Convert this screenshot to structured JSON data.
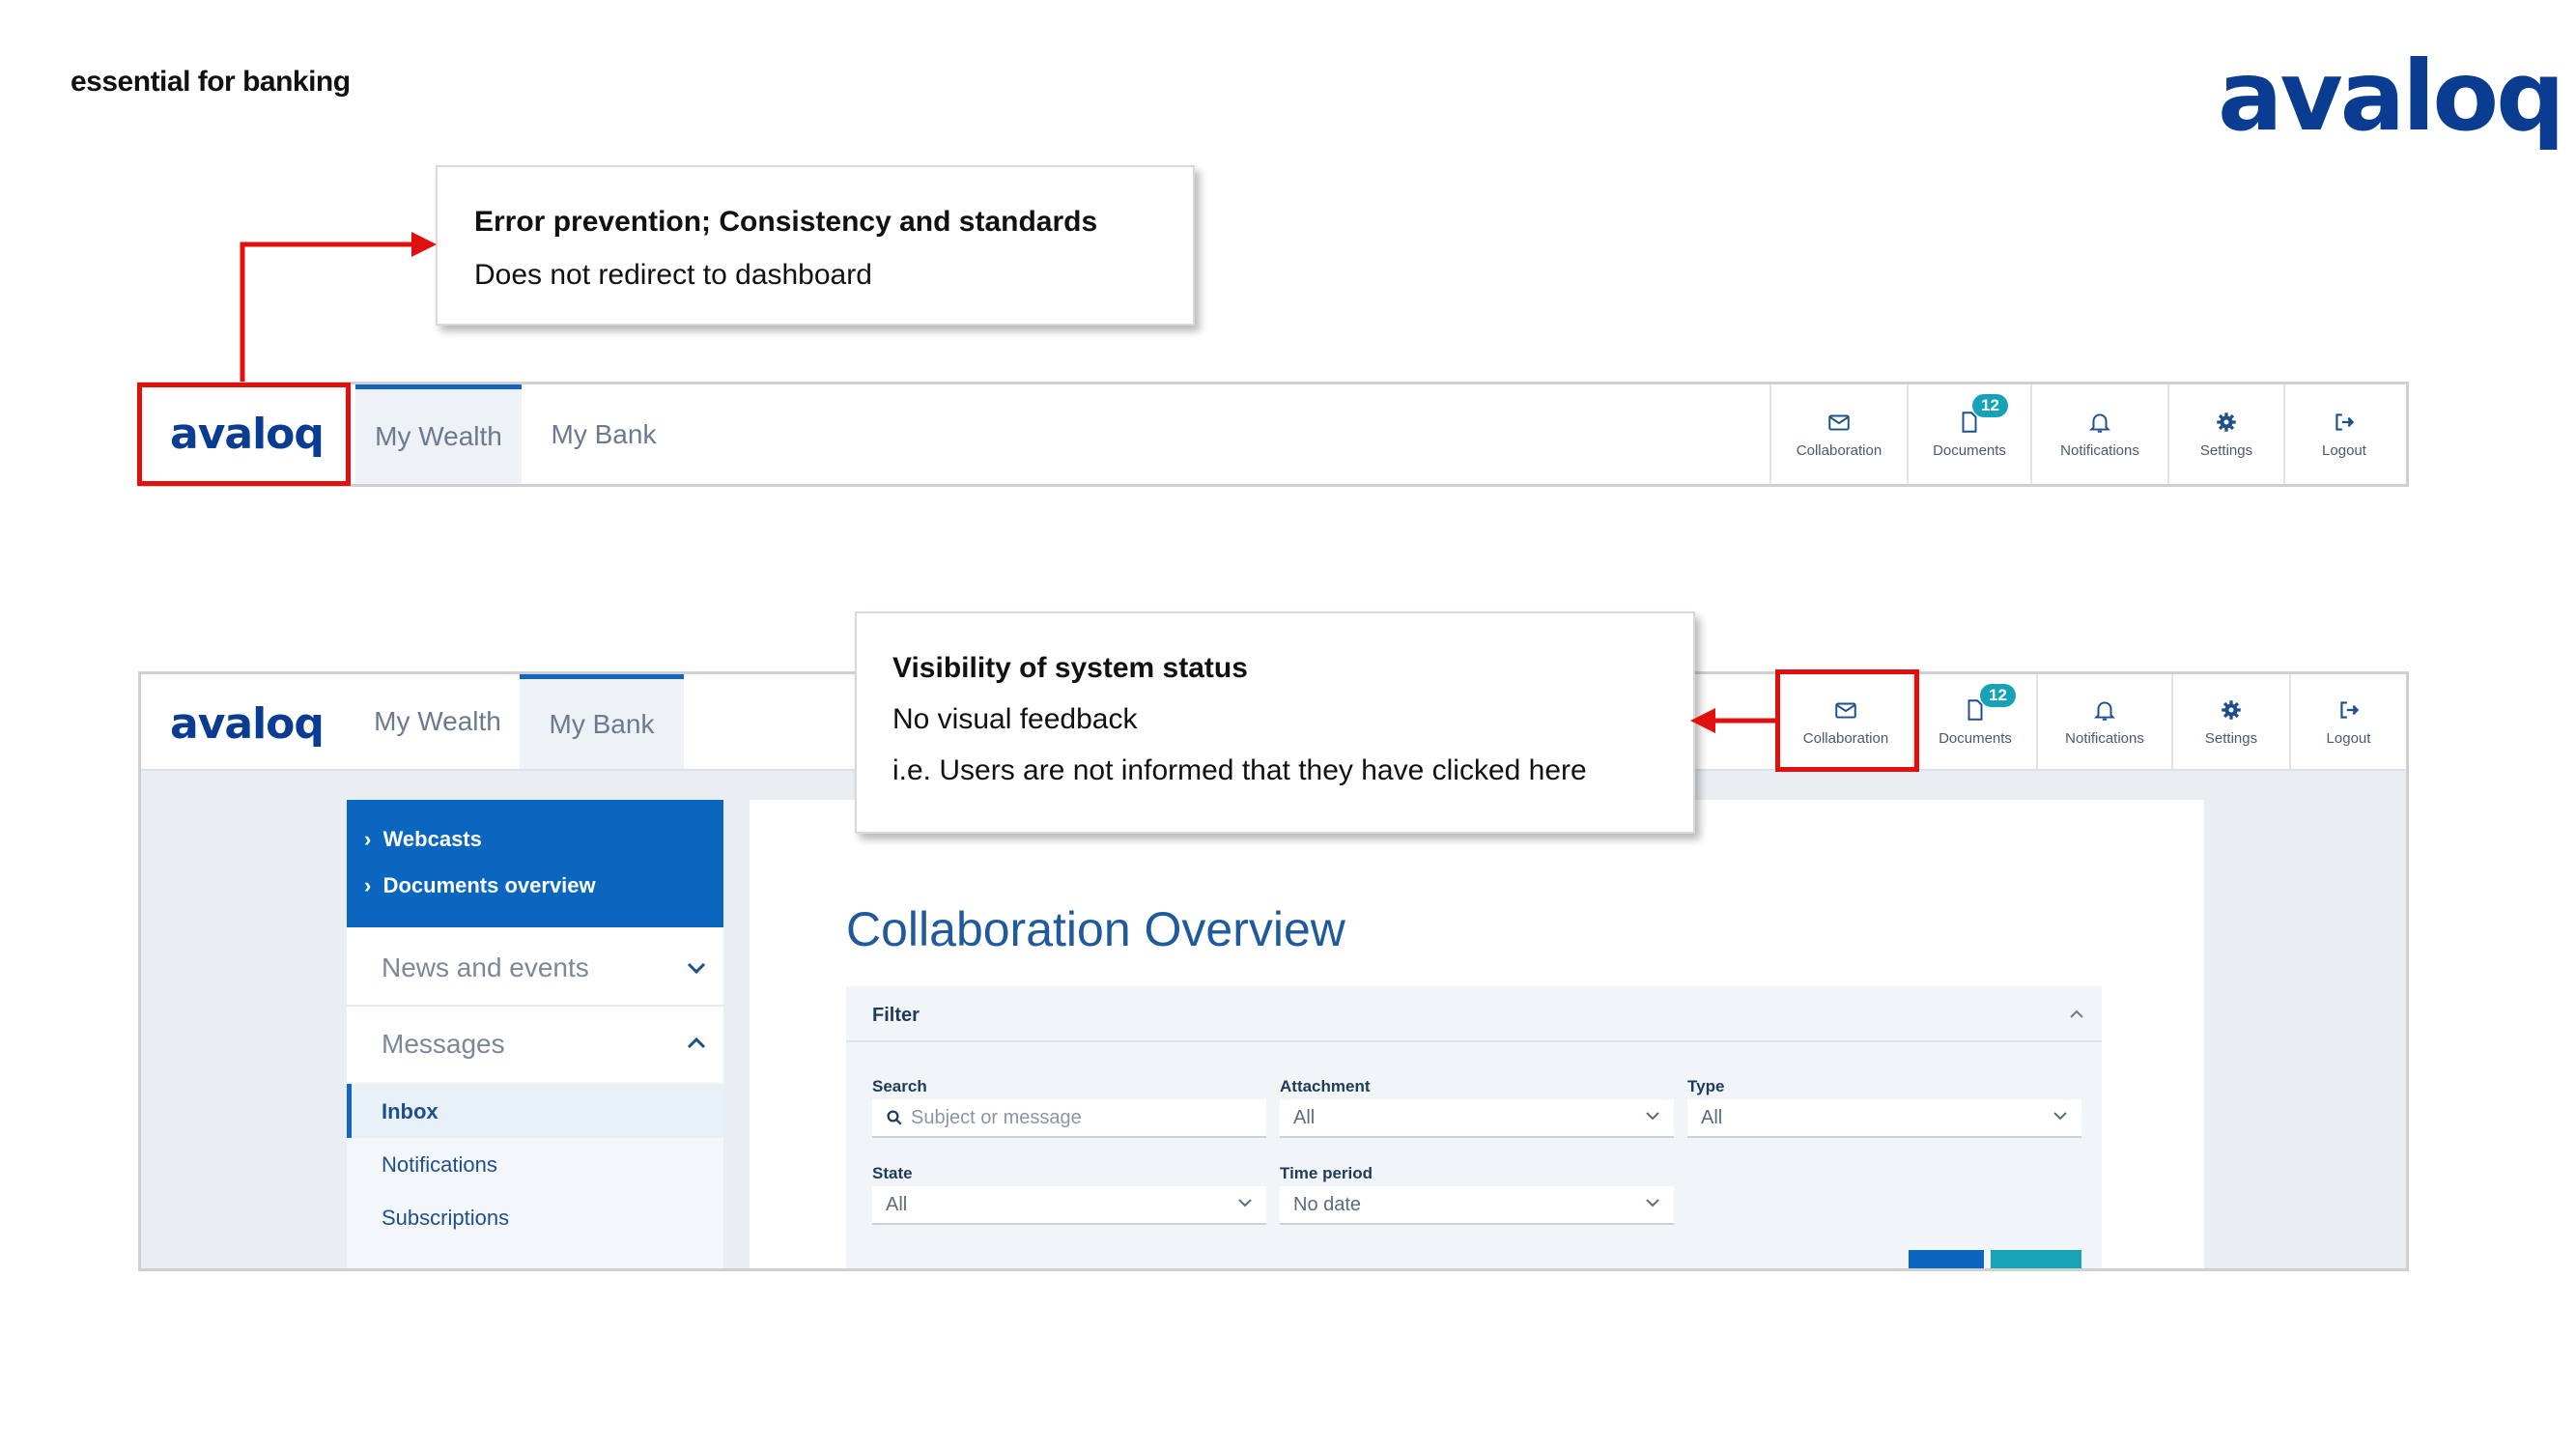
{
  "header": {
    "tagline": "essential for banking",
    "logo": "avaloq"
  },
  "callouts": [
    {
      "title": "Error prevention; Consistency and standards",
      "lines": [
        "Does not redirect to dashboard"
      ]
    },
    {
      "title": "Visibility of system status",
      "lines": [
        "No visual feedback",
        "i.e. Users are not informed that they have clicked here"
      ]
    }
  ],
  "app": {
    "logo": "avaloq",
    "tabs": [
      "My Wealth",
      "My Bank"
    ],
    "nav": [
      {
        "label": "Collaboration",
        "icon": "envelope-icon"
      },
      {
        "label": "Documents",
        "icon": "document-icon",
        "badge": "12"
      },
      {
        "label": "Notifications",
        "icon": "bell-icon"
      },
      {
        "label": "Settings",
        "icon": "gear-icon"
      },
      {
        "label": "Logout",
        "icon": "logout-icon"
      }
    ]
  },
  "sidebar": {
    "top_items": [
      "Webcasts",
      "Documents overview"
    ],
    "sections": [
      "News and events",
      "Messages"
    ],
    "message_items": [
      "Inbox",
      "Notifications",
      "Subscriptions"
    ]
  },
  "main": {
    "title": "Collaboration Overview",
    "filter": {
      "heading": "Filter",
      "search_label": "Search",
      "search_placeholder": "Subject or message",
      "attachment_label": "Attachment",
      "attachment_value": "All",
      "type_label": "Type",
      "type_value": "All",
      "state_label": "State",
      "state_value": "All",
      "time_label": "Time period",
      "time_value": "No date"
    }
  },
  "colors": {
    "brand": "#0a3d91",
    "accent": "#1565c0",
    "highlight": "#e01010",
    "badge": "#17a2b8"
  }
}
